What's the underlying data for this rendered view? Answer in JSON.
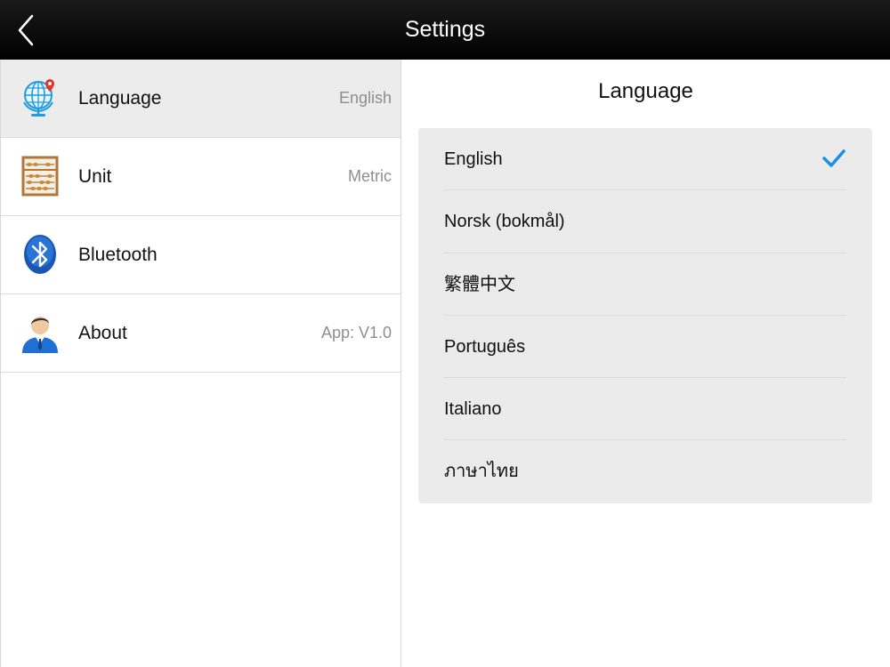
{
  "header": {
    "title": "Settings"
  },
  "sidebar": {
    "items": [
      {
        "label": "Language",
        "value": "English",
        "icon": "globe-icon",
        "selected": true
      },
      {
        "label": "Unit",
        "value": "Metric",
        "icon": "abacus-icon",
        "selected": false
      },
      {
        "label": "Bluetooth",
        "value": "",
        "icon": "bluetooth-icon",
        "selected": false
      },
      {
        "label": "About",
        "value": "App: V1.0",
        "icon": "user-icon",
        "selected": false
      }
    ]
  },
  "detail": {
    "title": "Language",
    "languages": [
      {
        "label": "English",
        "checked": true
      },
      {
        "label": "Norsk (bokmål)",
        "checked": false
      },
      {
        "label": "繁體中文",
        "checked": false
      },
      {
        "label": "Português",
        "checked": false
      },
      {
        "label": "Italiano",
        "checked": false
      },
      {
        "label": "ภาษาไทย",
        "checked": false
      }
    ]
  },
  "colors": {
    "accent": "#1a8fe3",
    "topbar": "#000000",
    "selected_row": "#ececec"
  }
}
